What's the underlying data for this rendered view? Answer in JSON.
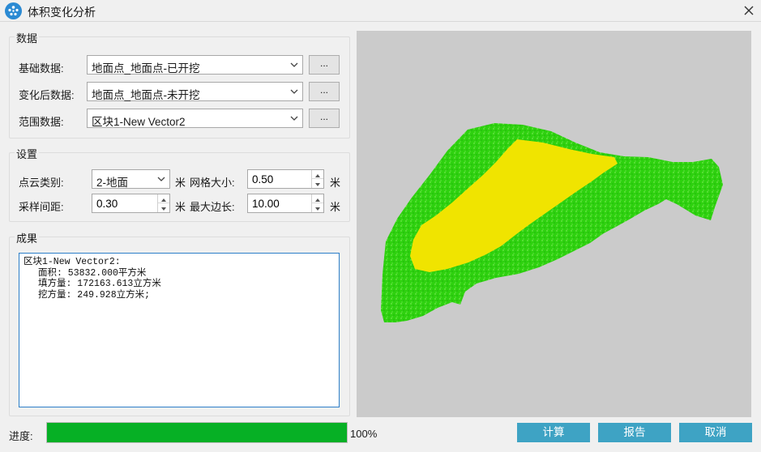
{
  "window": {
    "title": "体积变化分析",
    "icon": "app-logo-icon"
  },
  "data_group": {
    "legend": "数据",
    "rows": [
      {
        "label": "基础数据:",
        "value": "地面点_地面点-已开挖",
        "browse": "..."
      },
      {
        "label": "变化后数据:",
        "value": "地面点_地面点-未开挖",
        "browse": "..."
      },
      {
        "label": "范围数据:",
        "value": "区块1-New Vector2",
        "browse": "..."
      }
    ]
  },
  "settings_group": {
    "legend": "设置",
    "point_class_label": "点云类别:",
    "point_class_value": "2-地面",
    "grid_size_label": "网格大小:",
    "grid_size_value": "0.50",
    "sample_interval_label": "采样间距:",
    "sample_interval_value": "0.30",
    "max_edge_label": "最大边长:",
    "max_edge_value": "10.00",
    "unit": "米"
  },
  "result_group": {
    "legend": "成果",
    "lines": [
      "区块1-New Vector2:",
      "面积: 53832.000平方米",
      "填方量: 172163.613立方米",
      "挖方量: 249.928立方米;"
    ]
  },
  "progress": {
    "label": "进度:",
    "percent_text": "100%",
    "value": 1.0,
    "color": "#06b025"
  },
  "buttons": {
    "compute": "计算",
    "report": "报告",
    "cancel": "取消"
  },
  "colors": {
    "accent": "#3ea3c4",
    "terrain_green": "#2ed10f",
    "fill_yellow": "#f0e400",
    "preview_bg": "#cbcbcb"
  }
}
